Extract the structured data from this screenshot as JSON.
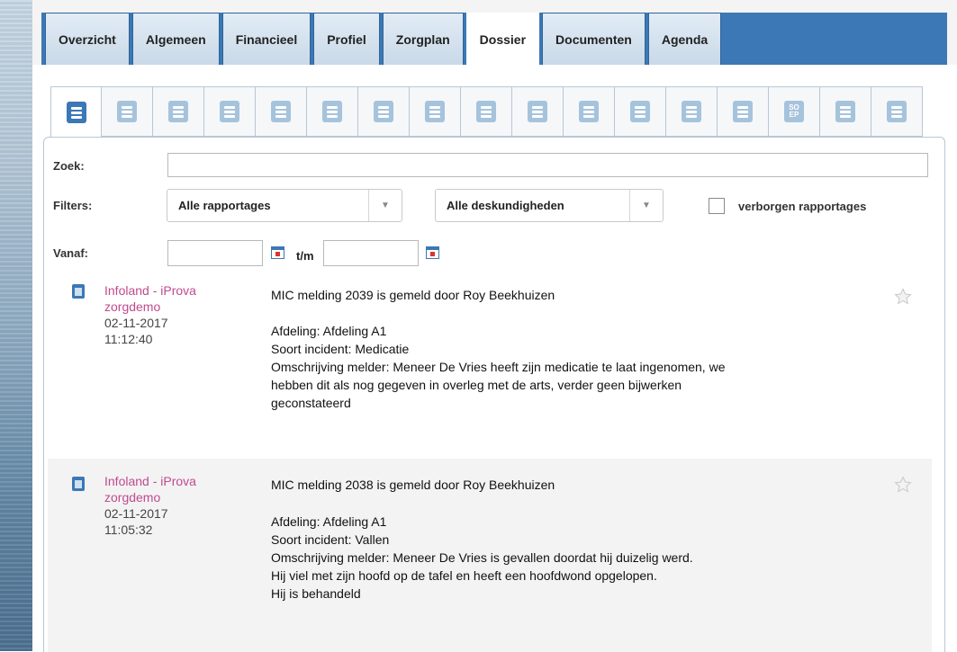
{
  "top_tabs": [
    {
      "label": "Overzicht",
      "active": false
    },
    {
      "label": "Algemeen",
      "active": false
    },
    {
      "label": "Financieel",
      "active": false
    },
    {
      "label": "Profiel",
      "active": false
    },
    {
      "label": "Zorgplan",
      "active": false
    },
    {
      "label": "Dossier",
      "active": true
    },
    {
      "label": "Documenten",
      "active": false
    },
    {
      "label": "Agenda",
      "active": false
    }
  ],
  "icon_tabs": [
    {
      "icon": "document-icon",
      "active": true
    },
    {
      "icon": "notepad-icon"
    },
    {
      "icon": "gauge-icon"
    },
    {
      "icon": "heartbeat-icon"
    },
    {
      "icon": "thermometer-icon"
    },
    {
      "icon": "drop-icon"
    },
    {
      "icon": "cup-icon"
    },
    {
      "icon": "bandage-icon"
    },
    {
      "icon": "medical-cross-icon"
    },
    {
      "icon": "arch-icon"
    },
    {
      "icon": "clipboard-icon"
    },
    {
      "icon": "face-icon"
    },
    {
      "icon": "c2-icon"
    },
    {
      "icon": "person-icon"
    },
    {
      "icon": "soep-icon",
      "text": "SO EP"
    },
    {
      "icon": "bars-icon"
    },
    {
      "icon": "chart-icon"
    }
  ],
  "filters": {
    "zoek_label": "Zoek:",
    "search_value": "",
    "filters_label": "Filters:",
    "rapportages_select": "Alle rapportages",
    "deskundigheden_select": "Alle deskundigheden",
    "hidden_label": "verborgen rapportages",
    "hidden_checked": false,
    "vanaf_label": "Vanaf:",
    "tm_label": "t/m",
    "date_from": "",
    "date_to": ""
  },
  "reports": [
    {
      "author": "Infoland - iProva zorgdemo",
      "date": "02-11-2017",
      "time": "11:12:40",
      "title": "MIC melding 2039 is gemeld door Roy Beekhuizen",
      "lines": [
        "Afdeling: Afdeling A1",
        "Soort incident: Medicatie",
        "Omschrijving melder: Meneer De Vries heeft zijn medicatie te laat ingenomen, we hebben dit als nog gegeven in overleg met de arts, verder geen bijwerken geconstateerd"
      ]
    },
    {
      "author": "Infoland - iProva zorgdemo",
      "date": "02-11-2017",
      "time": "11:05:32",
      "title": "MIC melding 2038 is gemeld door Roy Beekhuizen",
      "lines": [
        "Afdeling: Afdeling A1",
        "Soort incident: Vallen",
        "Omschrijving melder: Meneer De Vries is gevallen doordat hij duizelig werd.",
        "Hij viel met zijn hoofd op de tafel en heeft een hoofdwond opgelopen.",
        "Hij is behandeld"
      ]
    }
  ],
  "colors": {
    "tab_band": "#3b78b5",
    "author": "#c04a8f",
    "icon": "#a6c3dc"
  }
}
